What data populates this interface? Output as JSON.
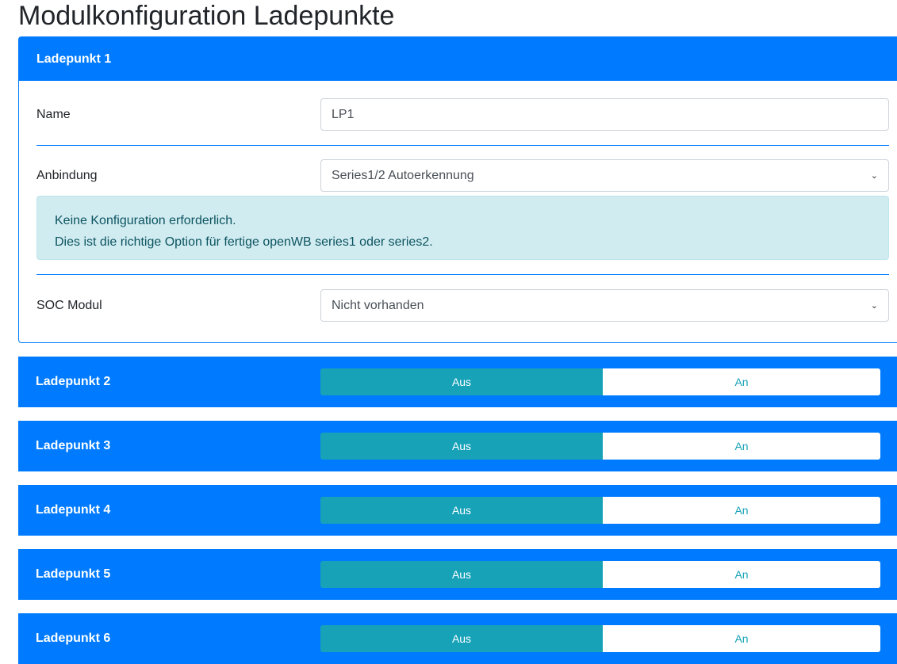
{
  "title": "Modulkonfiguration Ladepunkte",
  "lp1": {
    "header": "Ladepunkt 1",
    "name_label": "Name",
    "name_value": "LP1",
    "anbindung_label": "Anbindung",
    "anbindung_value": "Series1/2 Autoerkennung",
    "info_line1": "Keine Konfiguration erforderlich.",
    "info_line2": "Dies ist die richtige Option für fertige openWB series1 oder series2.",
    "soc_label": "SOC Modul",
    "soc_value": "Nicht vorhanden"
  },
  "others": [
    {
      "header": "Ladepunkt 2",
      "off": "Aus",
      "on": "An",
      "state": "Aus"
    },
    {
      "header": "Ladepunkt 3",
      "off": "Aus",
      "on": "An",
      "state": "Aus"
    },
    {
      "header": "Ladepunkt 4",
      "off": "Aus",
      "on": "An",
      "state": "Aus"
    },
    {
      "header": "Ladepunkt 5",
      "off": "Aus",
      "on": "An",
      "state": "Aus"
    },
    {
      "header": "Ladepunkt 6",
      "off": "Aus",
      "on": "An",
      "state": "Aus"
    }
  ]
}
